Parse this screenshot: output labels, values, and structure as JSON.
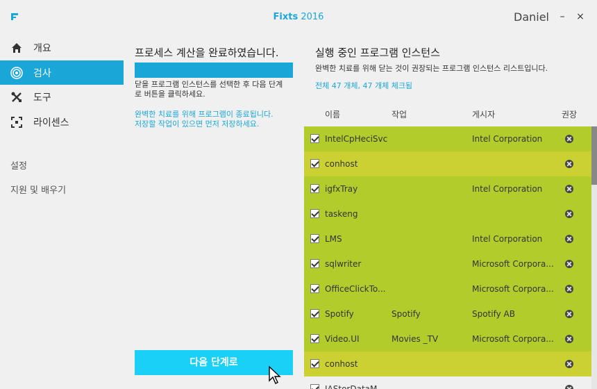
{
  "window": {
    "title_name": "Fixts",
    "title_year": "2016",
    "user": "Daniel",
    "minimize": "–",
    "close": "×"
  },
  "sidebar": {
    "items": [
      {
        "label": "개요",
        "icon": "home-icon"
      },
      {
        "label": "검사",
        "icon": "target-icon",
        "active": true
      },
      {
        "label": "도구",
        "icon": "tools-icon"
      },
      {
        "label": "라이센스",
        "icon": "license-icon"
      }
    ],
    "settings": "설정",
    "support": "지원 및 배우기"
  },
  "scan": {
    "title": "프로세스 계산을 완료하였습니다.",
    "progress": 1.0,
    "desc_line1": "닫을 프로그램 인스턴스를 선택한 후 다음 단계",
    "desc_line2": "로 버튼을 클릭하세요.",
    "note_line1": "완벽한 치료를 위해 프로그램이 종료됩니다.",
    "note_line2": "저장할 작업이 있으면 먼저 저장하세요.",
    "next_button": "다음 단계로"
  },
  "instances": {
    "title": "실행 중인 프로그램 인스턴스",
    "subtitle": "완벽한 치료를 위해 닫는 것이 권장되는 프로그램 인스턴스 리스트입니다.",
    "count_text": "전체 47 개체, 47 개체 체크됨",
    "columns": {
      "name": "이름",
      "task": "작업",
      "publisher": "게시자",
      "recommend": "권장"
    },
    "rows": [
      {
        "name": "IntelCpHeciSvc",
        "task": "",
        "publisher": "Intel Corporation",
        "checked": true
      },
      {
        "name": "conhost",
        "task": "",
        "publisher": "",
        "checked": true
      },
      {
        "name": "igfxTray",
        "task": "",
        "publisher": "Intel Corporation",
        "checked": true
      },
      {
        "name": "taskeng",
        "task": "",
        "publisher": "",
        "checked": true
      },
      {
        "name": "LMS",
        "task": "",
        "publisher": "Intel Corporation",
        "checked": true
      },
      {
        "name": "sqlwriter",
        "task": "",
        "publisher": "Microsoft Corpora...",
        "checked": true
      },
      {
        "name": "OfficeClickTo...",
        "task": "",
        "publisher": "Microsoft Corpora...",
        "checked": true
      },
      {
        "name": "Spotify",
        "task": "Spotify",
        "publisher": "Spotify AB",
        "checked": true
      },
      {
        "name": "Video.UI",
        "task": "Movies _TV",
        "publisher": "Microsoft Corpora...",
        "checked": true
      },
      {
        "name": "conhost",
        "task": "",
        "publisher": "",
        "checked": true
      },
      {
        "name": "IAStorDataM...",
        "task": "",
        "publisher": "",
        "checked": true
      }
    ]
  },
  "colors": {
    "accent": "#1aa7d8",
    "button": "#1ad0f5",
    "row_green": "#b1cc2b",
    "row_yellow": "#cbd132",
    "row_white": "#f0f0f0"
  }
}
